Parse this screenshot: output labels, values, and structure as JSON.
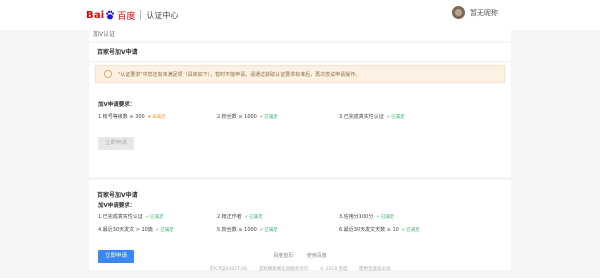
{
  "header": {
    "logo_bai": "Bai",
    "logo_du": "du",
    "logo_cn": "百度",
    "site_name": "认证中心",
    "username": "暂无昵称"
  },
  "page_title": "加V认证",
  "card1": {
    "title": "百家号加V申请",
    "notice": "\"认证要求\"中您还有未满足项（具体如下），暂时不能申请。请通过获取认证要求标准后，再次尝试申请操作。",
    "req_title": "加V申请要求：",
    "requirements": [
      {
        "label": "1.帐号等级数 ≥ 300",
        "status": "未满足",
        "ok": false
      },
      {
        "label": "2.粉丝数 ≥ 1000",
        "status": "已满足",
        "ok": true
      },
      {
        "label": "3.已完成真实性认证",
        "status": "已满足",
        "ok": true
      }
    ],
    "button": "立即申请"
  },
  "card2": {
    "title": "百家号加V申请",
    "req_title": "加V申请要求：",
    "requirements": [
      {
        "label": "1.已完成真实性认证",
        "status": "已满足",
        "ok": true
      },
      {
        "label": "2.帐正作者",
        "status": "已满足",
        "ok": true
      },
      {
        "label": "3.信用分100分",
        "status": "已满足",
        "ok": true
      },
      {
        "label": "4.最近30天发文 > 10篇",
        "status": "已满足",
        "ok": true
      },
      {
        "label": "5.粉丝数 ≥ 1000",
        "status": "已满足",
        "ok": true
      },
      {
        "label": "6.最近30天发文天数 ≥ 10",
        "status": "已满足",
        "ok": true
      }
    ],
    "button": "立即申请"
  },
  "footer": {
    "links": [
      "百度首页",
      "使用百度"
    ],
    "copy": [
      "京ICP证030173号",
      "互联网新闻信息服务许可",
      "© 2018 百度",
      "使用百度前必读"
    ]
  },
  "colors": {
    "primary": "#3c87f6",
    "ok": "#3bb36c",
    "warn": "#f39d33",
    "notice_bg": "#fdf1e3"
  }
}
